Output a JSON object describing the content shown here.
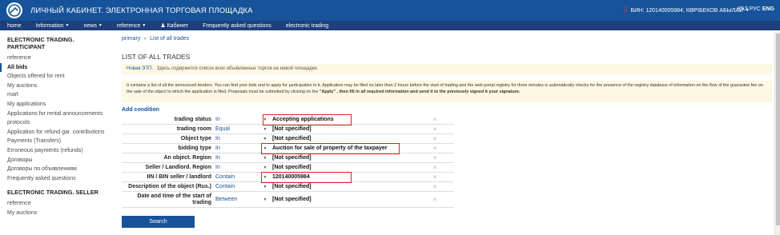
{
  "header": {
    "title": "ЛИЧНЫЙ КАБИНЕТ. ЭЛЕКТРОННАЯ ТОРГОВАЯ ПЛОЩАДКА",
    "user": "БИН: 120140005984; КӨРІБЕКОВ АБЫЛАЙ",
    "langs": [
      "ҚАЗ",
      "РУС",
      "ENG"
    ]
  },
  "nav": [
    {
      "label": "home",
      "caret": false
    },
    {
      "label": "Information",
      "caret": true
    },
    {
      "label": "news",
      "caret": true
    },
    {
      "label": "reference",
      "caret": true
    },
    {
      "label": "Кабинет",
      "caret": false
    },
    {
      "label": "Frequently asked questions",
      "caret": false
    },
    {
      "label": "electronic trading",
      "caret": false
    }
  ],
  "sidebar": {
    "section1": "ELECTRONIC TRADING. PARTICIPANT",
    "items1": [
      "reference",
      "All bids",
      "Objects offered for rent",
      "My auctions",
      "mart",
      "My applications",
      "Applications for rental announcements",
      "protocols",
      "Application for refund gar. contributions",
      "Payments (Transfers)",
      "Erroneous payments (refunds)",
      "Договоры",
      "Договоры по объявлениям",
      "Frequently asked questions"
    ],
    "section2": "ELECTRONIC TRADING. SELLER",
    "items2": [
      "reference",
      "My auctions"
    ]
  },
  "main": {
    "breadcrumb": {
      "root": "primary",
      "sep": "»",
      "current": "List of all trades"
    },
    "title": "LIST OF ALL TRADES",
    "note_title": "Новая ЭТП.",
    "note_text": "Здесь содержится список всех объявленных торгов на новой площадке.",
    "info_text": "It contains a list of all the announced tenders. You can find your bids and to apply for participation in it. Application may be filed no later than 2 hours before the start of trading and the web portal registry for three minutes is automatically checks for the presence of the registry database of information on the flow of the guarantee fee on the sale of the object to which the application is filed. Proposals must be submitted by clicking on the ",
    "info_apply": "\"Apply\" , then fill in all required information and send it to the previously signed it your signature.",
    "add_condition": "Add condition",
    "conditions": [
      {
        "label": "trading status",
        "op": "In",
        "value": "Accepting applications"
      },
      {
        "label": "trading room",
        "op": "Equal",
        "value": "[Not specified]"
      },
      {
        "label": "Object type",
        "op": "In",
        "value": "[Not specified]"
      },
      {
        "label": "bidding type",
        "op": "In",
        "value": "Auction for sale of property of the taxpayer"
      },
      {
        "label": "An object. Region",
        "op": "In",
        "value": "[Not specified]"
      },
      {
        "label": "Seller / Landlord. Region",
        "op": "In",
        "value": "[Not specified]"
      },
      {
        "label": "IIN / BIN seller / landlord",
        "op": "Contain",
        "value": "120140005984"
      },
      {
        "label": "Description of the object (Rus.)",
        "op": "Contain",
        "value": "[Not specified]"
      },
      {
        "label": "Date and time of the start of trading",
        "op": "Between",
        "value": "[Not specified]"
      }
    ],
    "search_label": "Search"
  }
}
